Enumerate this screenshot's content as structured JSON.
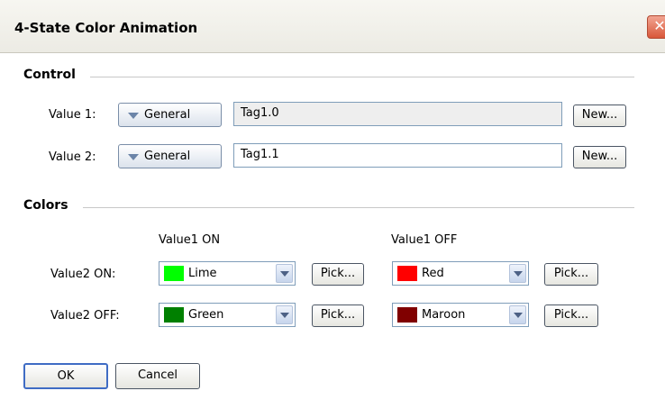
{
  "window": {
    "title": "4-State Color Animation",
    "close_glyph": "✕"
  },
  "control": {
    "heading": "Control",
    "rows": [
      {
        "label": "Value 1:",
        "dropdown": "General",
        "tag": "Tag1.0",
        "new_label": "New..."
      },
      {
        "label": "Value 2:",
        "dropdown": "General",
        "tag": "Tag1.1",
        "new_label": "New..."
      }
    ]
  },
  "colors": {
    "heading": "Colors",
    "col_headers": [
      "Value1 ON",
      "Value1 OFF"
    ],
    "rows": [
      {
        "label": "Value2 ON:",
        "cells": [
          {
            "name": "Lime",
            "hex": "#00ff00",
            "pick": "Pick..."
          },
          {
            "name": "Red",
            "hex": "#ff0000",
            "pick": "Pick..."
          }
        ]
      },
      {
        "label": "Value2 OFF:",
        "cells": [
          {
            "name": "Green",
            "hex": "#008000",
            "pick": "Pick..."
          },
          {
            "name": "Maroon",
            "hex": "#800000",
            "pick": "Pick..."
          }
        ]
      }
    ]
  },
  "buttons": {
    "ok": "OK",
    "cancel": "Cancel"
  }
}
